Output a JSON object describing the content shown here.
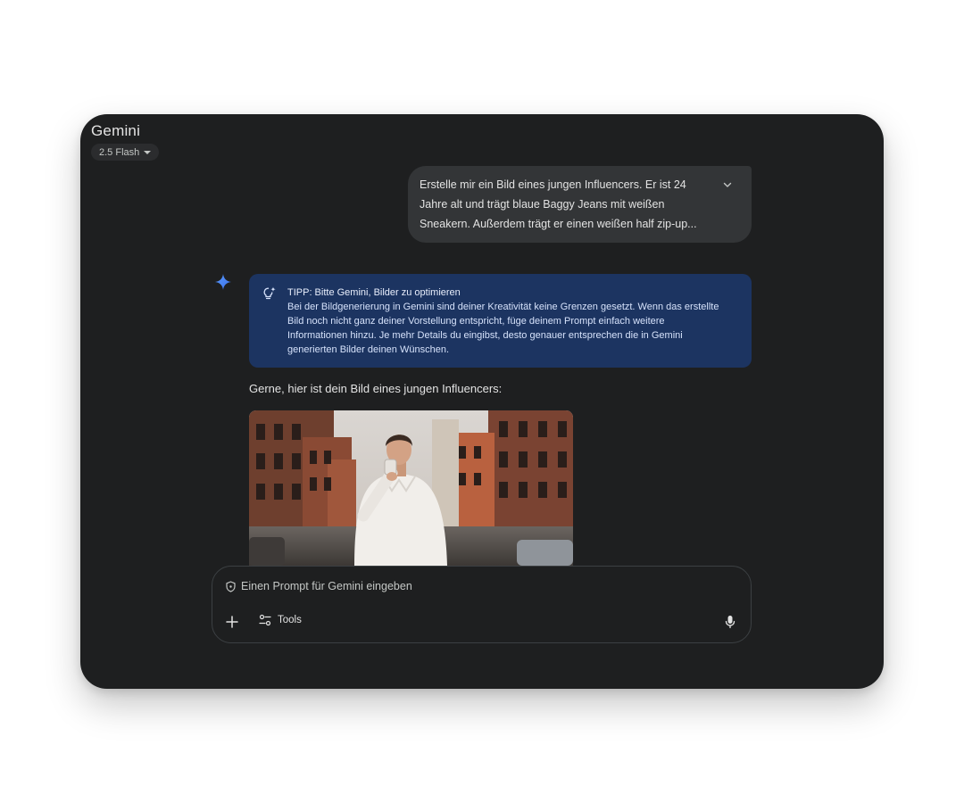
{
  "app": {
    "title": "Gemini",
    "model_label": "2.5 Flash"
  },
  "user_message": {
    "lines": [
      "Erstelle mir ein Bild eines jungen Influencers. Er ist 24",
      "Jahre alt und trägt blaue Baggy Jeans mit weißen",
      "Sneakern. Außerdem trägt er einen weißen half zip-up..."
    ],
    "expand_icon": "chevron-down-icon"
  },
  "tip": {
    "title": "TIPP: Bitte Gemini, Bilder zu optimieren",
    "lines": [
      "Bei der Bildgenerierung in Gemini sind deiner Kreativität keine Grenzen gesetzt. Wenn das erstellte",
      "Bild noch nicht ganz deiner Vorstellung entspricht, füge deinem Prompt einfach weitere",
      "Informationen hinzu. Je mehr Details du eingibst, desto genauer entsprechen die in Gemini",
      "generierten Bilder deinen Wünschen."
    ],
    "icon": "lightbulb-sparkle-icon"
  },
  "response": {
    "text": "Gerne, hier ist dein Bild eines jungen Influencers:"
  },
  "input": {
    "placeholder": "Einen Prompt für Gemini eingeben",
    "value": "",
    "tools_label": "Tools"
  },
  "colors": {
    "background": "#1e1f20",
    "user_bubble": "#333537",
    "tip_background": "#1c3461",
    "accent_star": "#4c8df6"
  }
}
